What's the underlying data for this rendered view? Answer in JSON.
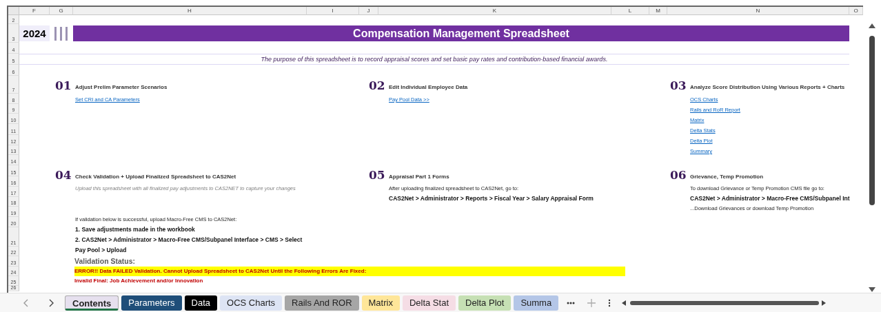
{
  "columns": [
    "F",
    "G",
    "H",
    "I",
    "J",
    "K",
    "L",
    "M",
    "N",
    "O"
  ],
  "rows": [
    "2",
    "3",
    "4",
    "5",
    "6",
    "7",
    "8",
    "9",
    "10",
    "11",
    "12",
    "13",
    "14",
    "15",
    "16",
    "17",
    "18",
    "19",
    "20",
    "21",
    "22",
    "23",
    "24",
    "25",
    "26"
  ],
  "header": {
    "year": "2024",
    "title": "Compensation Management Spreadsheet"
  },
  "purpose": "The purpose of this spreadsheet is to record appraisal scores and set basic pay rates and contribution-based financial awards.",
  "sections": [
    {
      "number": "01",
      "title": "Adjust Prelim Parameter Scenarios",
      "items": [
        {
          "kind": "link",
          "text": "Set CRI and CA Parameters"
        }
      ]
    },
    {
      "number": "02",
      "title": "Edit Individual Employee Data",
      "items": [
        {
          "kind": "link",
          "text": "Pay Pool Data >>"
        }
      ]
    },
    {
      "number": "03",
      "title": "Analyze Score Distribution Using Various Reports + Charts",
      "items": [
        {
          "kind": "link",
          "text": "OCS Charts"
        },
        {
          "kind": "link",
          "text": "Rails and RoR Report"
        },
        {
          "kind": "link",
          "text": "Matrix"
        },
        {
          "kind": "link",
          "text": "Delta Stats"
        },
        {
          "kind": "link",
          "text": "Delta Plot"
        },
        {
          "kind": "link",
          "text": "Summary"
        }
      ]
    },
    {
      "number": "04",
      "title": "Check Validation + Upload Finalized Spreadsheet to CAS2Net",
      "items": [
        {
          "kind": "note",
          "text": "Upload this spreadsheet with all finalized pay adjustments to CAS2NET to capture your changes"
        },
        {
          "kind": "intro",
          "text": "If validation below is successful, upload Macro-Free CMS to CAS2Net:"
        },
        {
          "kind": "step",
          "text": "1. Save adjustments made in the workbook"
        },
        {
          "kind": "step",
          "text": "2. CAS2Net > Administrator > Macro-Free CMS/Subpanel Interface >  CMS > Select Pay Pool > Upload"
        }
      ]
    },
    {
      "number": "05",
      "title": "Appraisal Part 1 Forms",
      "items": [
        {
          "kind": "text",
          "text": "After uploading finalized spreadsheet to CAS2Net, go to:"
        },
        {
          "kind": "path",
          "text": "CAS2Net > Administrator > Reports > Fiscal Year > Salary Appraisal Form"
        }
      ]
    },
    {
      "number": "06",
      "title": "Grievance, Temp Promotion",
      "items": [
        {
          "kind": "text",
          "text": "To download Grievance or Temp Promotion CMS file go to:"
        },
        {
          "kind": "path",
          "text": "CAS2Net > Administrator > Macro-Free CMS/Subpanel Int"
        },
        {
          "kind": "text",
          "text": "...Download Grievances or download Temp Promotion"
        }
      ]
    }
  ],
  "validation": {
    "label": "Validation Status:",
    "error": "ERROR!! Data FAILED Validation. Cannot Upload Spreadsheet to CAS2Net Until the Following Errors Are Fixed:",
    "detail": "Invalid Final: Job Achievement and/or Innovation"
  },
  "tabs": [
    {
      "label": "Contents",
      "selected": true,
      "color": "#e6e0ee"
    },
    {
      "label": "Parameters",
      "selected": false,
      "color": "#1f4e79"
    },
    {
      "label": "Data",
      "selected": false,
      "color": "#000000"
    },
    {
      "label": "OCS Charts",
      "selected": false,
      "color": "#dde4f4"
    },
    {
      "label": "Rails And ROR",
      "selected": false,
      "color": "#a6a6a6"
    },
    {
      "label": "Matrix",
      "selected": false,
      "color": "#ffe699"
    },
    {
      "label": "Delta Stat",
      "selected": false,
      "color": "#f5dde5"
    },
    {
      "label": "Delta Plot",
      "selected": false,
      "color": "#c6e0b4"
    },
    {
      "label": "Summa",
      "selected": false,
      "color": "#b4c6e7"
    }
  ]
}
